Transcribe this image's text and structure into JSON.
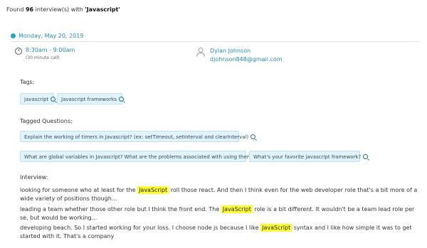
{
  "summary": {
    "prefix": "Found",
    "count": "96",
    "middle": "interview(s) with",
    "query": "'Javascript'"
  },
  "date": "Monday, May 20, 2019",
  "time": "8:30am - 9:00am",
  "call_length": "(30 minute call)",
  "person": {
    "name": "Dylan Johnson",
    "email": "djohnson848@gmail.com"
  },
  "tags_label": "Tags:",
  "tags": [
    "javascript",
    "Javascript frameworks"
  ],
  "tagged_questions_label": "Tagged Questions:",
  "questions": [
    "Explain the working of timers in Javascript? (ex: setTimeout, setInterval and clearInterval)",
    "What are global variables in Javascript? What are the problems associated with using them?",
    "What's your favorite javascript framework?"
  ],
  "interview_label": "Interview:",
  "interview_lines": [
    {
      "before": "looking for someone who at least for the ",
      "highlight": "JavaScript",
      "after": " roll those react. And then I think even for the web developer role that's a bit more of a wide variety of positions though..."
    },
    {
      "before": "leading a team whether those other role but I think the front end. The ",
      "highlight": "JavaScript",
      "after": " role is a bit different. It wouldn't be a team lead role per se, but would be working..."
    },
    {
      "before": "developing beach. So I started working for your loss. I choose node js because I like ",
      "highlight": "JavaScript",
      "after": " syntax and I like how simple it was to get started with it. That's a company"
    }
  ],
  "colors": {
    "accent": "#2a8ab3",
    "chip_bg": "#e2f3fb",
    "highlight": "#ffff33",
    "dot": "#1aa6c8"
  },
  "icons": {
    "clock": "clock-icon",
    "person": "person-icon",
    "chip": "search-icon"
  }
}
